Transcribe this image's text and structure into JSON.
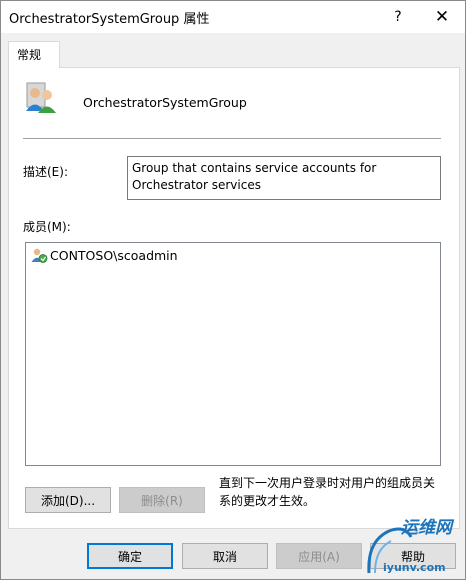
{
  "window": {
    "title": "OrchestratorSystemGroup 属性",
    "help_glyph": "?",
    "close_glyph": "✕"
  },
  "tabs": [
    {
      "label": "常规"
    }
  ],
  "general": {
    "group_name": "OrchestratorSystemGroup",
    "description_label": "描述(E):",
    "description_value": "Group that contains service accounts for Orchestrator services",
    "members_label": "成员(M):",
    "members": [
      {
        "name": "CONTOSO\\scoadmin",
        "icon": "user-icon"
      }
    ],
    "add_button": "添加(D)...",
    "remove_button": "删除(R)",
    "note": "直到下一次用户登录时对用户的组成员关系的更改才生效。"
  },
  "footer": {
    "ok": "确定",
    "cancel": "取消",
    "apply": "应用(A)",
    "help": "帮助"
  },
  "watermark": {
    "brand": "运维网",
    "url": "iyunv.com"
  },
  "colors": {
    "accent": "#0078d7",
    "watermark": "#1c75bc"
  }
}
